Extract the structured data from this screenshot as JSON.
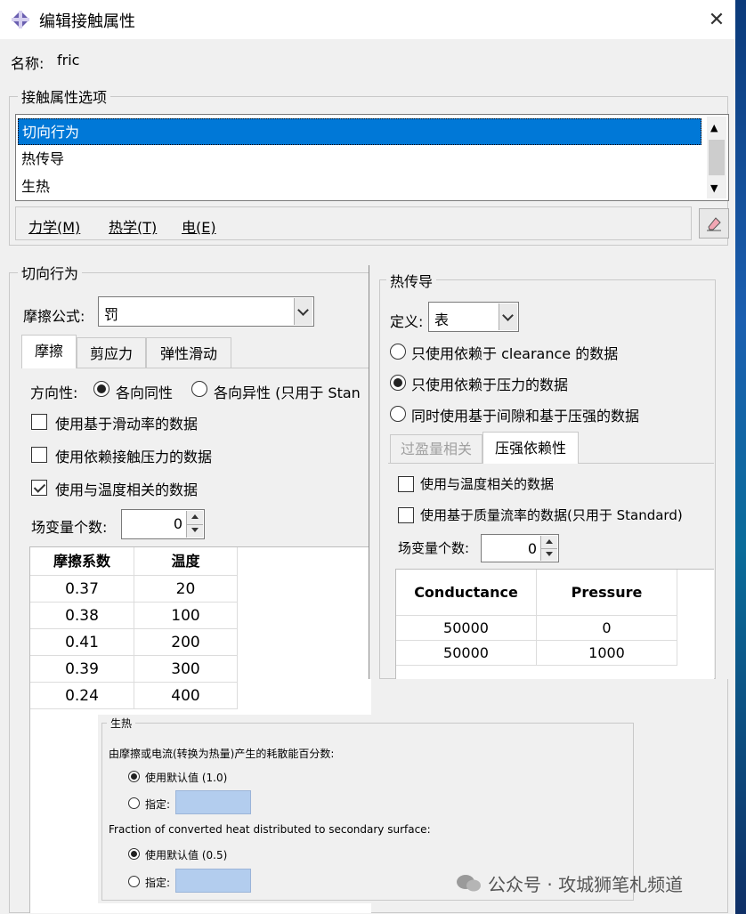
{
  "window": {
    "title": "编辑接触属性",
    "close": "✕"
  },
  "name": {
    "label": "名称:",
    "value": "fric"
  },
  "options_group": {
    "label": "接触属性选项",
    "items": [
      "切向行为",
      "热传导",
      "生热"
    ],
    "selected": 0,
    "menus": [
      "力学(M)",
      "热学(T)",
      "电(E)"
    ]
  },
  "tangential": {
    "group_label": "切向行为",
    "formula_label": "摩擦公式:",
    "formula_value": "罚",
    "tabs": [
      "摩擦",
      "剪应力",
      "弹性滑动"
    ],
    "direction_label": "方向性:",
    "direction_options": [
      "各向同性",
      "各向异性 (只用于 Stan"
    ],
    "checks": [
      {
        "label": "使用基于滑动率的数据",
        "checked": false
      },
      {
        "label": "使用依赖接触压力的数据",
        "checked": false
      },
      {
        "label": "使用与温度相关的数据",
        "checked": true
      }
    ],
    "field_vars_label": "场变量个数:",
    "field_vars_value": "0",
    "table": {
      "headers": [
        "摩擦系数",
        "温度"
      ],
      "rows": [
        [
          "0.37",
          "20"
        ],
        [
          "0.38",
          "100"
        ],
        [
          "0.41",
          "200"
        ],
        [
          "0.39",
          "300"
        ],
        [
          "0.24",
          "400"
        ]
      ]
    }
  },
  "thermal": {
    "group_label": "热传导",
    "define_label": "定义:",
    "define_value": "表",
    "radios": [
      {
        "label": "只使用依赖于 clearance 的数据",
        "on": false
      },
      {
        "label": "只使用依赖于压力的数据",
        "on": true
      },
      {
        "label": "同时使用基于间隙和基于压强的数据",
        "on": false
      }
    ],
    "tabs": [
      "过盈量相关",
      "压强依赖性"
    ],
    "checks": [
      {
        "label": "使用与温度相关的数据",
        "checked": false
      },
      {
        "label": "使用基于质量流率的数据(只用于 Standard)",
        "checked": false
      }
    ],
    "field_vars_label": "场变量个数:",
    "field_vars_value": "0",
    "table": {
      "headers": [
        "Conductance",
        "Pressure"
      ],
      "rows": [
        [
          "50000",
          "0"
        ],
        [
          "50000",
          "1000"
        ]
      ]
    }
  },
  "heat_gen": {
    "group_label": "生热",
    "fraction_label": "由摩擦或电流(转换为热量)产生的耗散能百分数:",
    "fraction_default": "使用默认值 (1.0)",
    "fraction_specify": "指定:",
    "secondary_label": "Fraction of converted heat distributed to secondary surface:",
    "secondary_default": "使用默认值 (0.5)",
    "secondary_specify": "指定:"
  },
  "watermark": "公众号 · 攻城狮笔札频道"
}
